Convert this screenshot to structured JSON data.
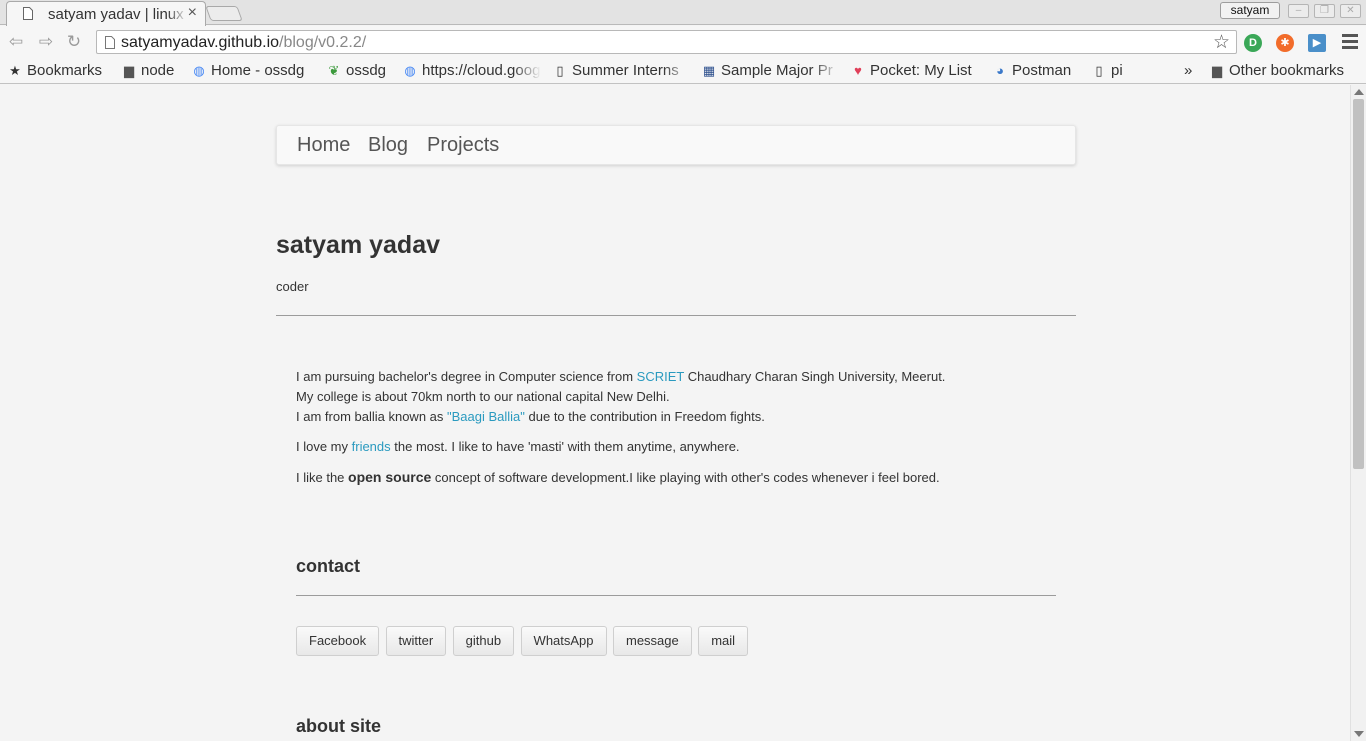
{
  "browser": {
    "tab_title": "satyam yadav | linux",
    "tab_close": "×",
    "profile_name": "satyam",
    "url_host": "satyamyadav.github.io",
    "url_path": "/blog/v0.2.2/",
    "bookmarks": [
      {
        "label": "Bookmarks",
        "icon": "★"
      },
      {
        "label": "node",
        "icon": "folder"
      },
      {
        "label": "Home - ossdg",
        "icon": "google"
      },
      {
        "label": "ossdg",
        "icon": "leaf"
      },
      {
        "label": "https://cloud.google",
        "icon": "google"
      },
      {
        "label": "Summer Interns",
        "icon": "page"
      },
      {
        "label": "Sample Major Pr",
        "icon": "grid"
      },
      {
        "label": "Pocket: My List",
        "icon": "pocket"
      },
      {
        "label": "Postman",
        "icon": "globe"
      },
      {
        "label": "pi",
        "icon": "page"
      }
    ],
    "overflow_chevron": "»",
    "other_bookmarks": "Other bookmarks"
  },
  "nav": {
    "home": "Home",
    "blog": "Blog",
    "projects": "Projects"
  },
  "header": {
    "title": "satyam yadav",
    "subtitle": "coder"
  },
  "about": {
    "p1_a": "I am pursuing bachelor's degree in Computer science from ",
    "p1_link": "SCRIET",
    "p1_b": " Chaudhary Charan Singh University, Meerut.",
    "p1_line2": "My college is about 70km north to our national capital New Delhi.",
    "p1_line3_a": "I am from ballia known as ",
    "p1_line3_link": "\"Baagi Ballia\"",
    "p1_line3_b": " due to the contribution in Freedom fights.",
    "p2_a": "I love my ",
    "p2_link": "friends",
    "p2_b": " the most. I like to have 'masti' with them anytime, anywhere.",
    "p3_a": "I like the ",
    "p3_bold": "open source",
    "p3_b": " concept of software development.I like playing with other's codes whenever i feel bored."
  },
  "contact": {
    "heading": "contact",
    "buttons": [
      "Facebook",
      "twitter",
      "github",
      "WhatsApp",
      "message",
      "mail"
    ]
  },
  "about_site": {
    "heading": "about site"
  },
  "colors": {
    "link": "#2a9abf",
    "page_bg": "#f4f4f4"
  }
}
